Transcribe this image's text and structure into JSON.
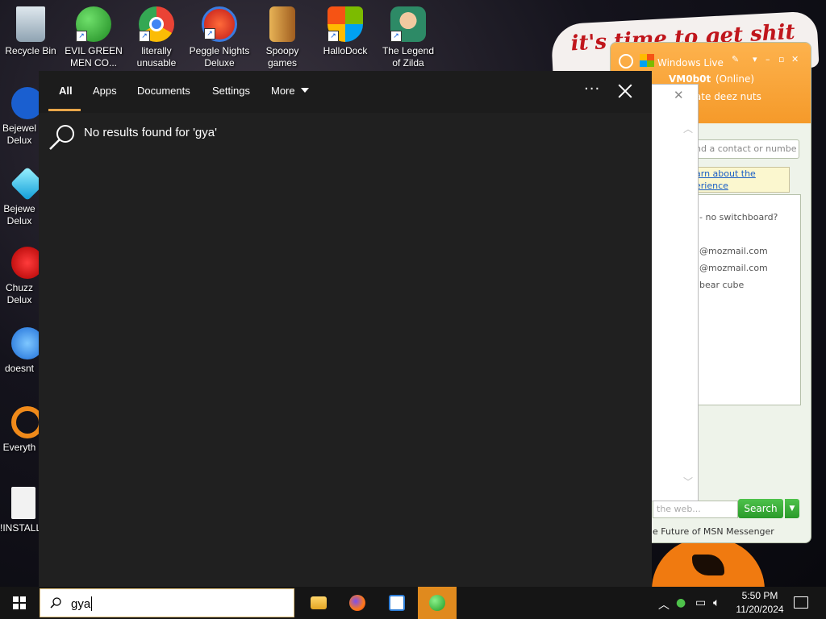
{
  "desktop": {
    "top_icons": [
      {
        "label": "Recycle Bin",
        "icon": "recycle-bin-icon"
      },
      {
        "label": "EVIL GREEN MEN CO...",
        "icon": "messenger-people-icon"
      },
      {
        "label": "literally unusable",
        "icon": "chrome-icon"
      },
      {
        "label": "Peggle Nights Deluxe",
        "icon": "peggle-icon"
      },
      {
        "label": "Spoopy games",
        "icon": "spoopy-folder-icon"
      },
      {
        "label": "HalloDock",
        "icon": "windows-shield-icon"
      },
      {
        "label": "The Legend of Zilda",
        "icon": "zilda-icon"
      }
    ],
    "left_icons": [
      {
        "line1": "Bejewel",
        "line2": "Delux"
      },
      {
        "line1": "Bejewe",
        "line2": "Delux"
      },
      {
        "line1": "Chuzz",
        "line2": "Delux"
      },
      {
        "line1": "doesnt",
        "line2": ""
      },
      {
        "line1": "Everyth",
        "line2": ""
      },
      {
        "line1": "!INSTALL",
        "line2": ""
      }
    ],
    "wallpaper_text": "it's time to get shit"
  },
  "messenger": {
    "title": "Windows Live",
    "username": "VM0b0t",
    "status": "(Online)",
    "personal_message": "rate deez nuts",
    "search_placeholder": "nd a contact or numbe",
    "learn_text_1": "arn about the",
    "learn_text_2": "erience",
    "lines": [
      "- no switchboard?",
      "@mozmail.com",
      "@mozmail.com",
      "bear cube"
    ],
    "web_placeholder": "the web...",
    "search_button": "Search",
    "footer": "e Future of MSN Messenger"
  },
  "search_panel": {
    "tabs": [
      "All",
      "Apps",
      "Documents",
      "Settings",
      "More"
    ],
    "active_tab": "All",
    "more_menu": "···",
    "no_results": "No results found for 'gya'"
  },
  "taskbar": {
    "search_value": "gya",
    "apps": [
      {
        "name": "file-explorer",
        "icon": "folder-icon"
      },
      {
        "name": "firefox",
        "icon": "firefox-icon"
      },
      {
        "name": "notepad-app",
        "icon": "window-app-icon"
      },
      {
        "name": "messenger",
        "icon": "messenger-icon"
      }
    ],
    "clock": {
      "time": "5:50 PM",
      "date": "11/20/2024"
    },
    "accent": "#e08a1e"
  }
}
